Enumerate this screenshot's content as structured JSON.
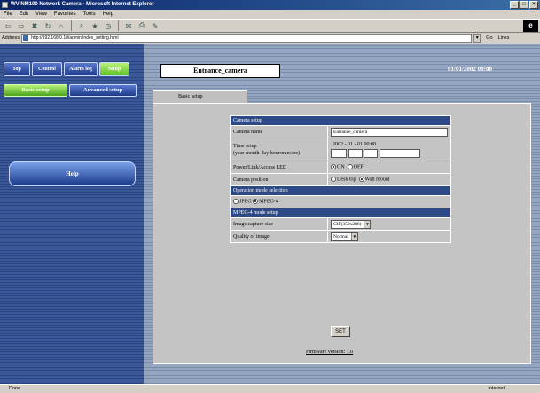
{
  "window": {
    "title": "WV-NM100 Network Camera - Microsoft Internet Explorer"
  },
  "menu": [
    "File",
    "Edit",
    "View",
    "Favorites",
    "Tools",
    "Help"
  ],
  "address": {
    "label": "Address",
    "url": "http://192.168.0.10/admin/index_setting.html",
    "go": "Go",
    "links": "Links"
  },
  "nav": {
    "tabs": [
      {
        "label": "Top",
        "active": false
      },
      {
        "label": "Control",
        "active": false
      },
      {
        "label": "Alarm log",
        "active": false
      },
      {
        "label": "Setup",
        "active": true
      }
    ],
    "subtabs": [
      {
        "label": "Basic setup",
        "active": true
      },
      {
        "label": "Advanced setup",
        "active": false
      }
    ],
    "help": "Help"
  },
  "camera_name": "Entrance_camera",
  "datetime": "01/01/2002  00:00",
  "panel": {
    "tab_label": "Basic setup",
    "camera_setup_header": "Camera setup",
    "camera_name_label": "Camera name",
    "camera_name_value": "Entrance_camera",
    "time_setup_label": "Time setup",
    "time_setup_sub": "(year-month-day hour:min:sec)",
    "time_current": "2002 - 01 - 01   00:00",
    "power_led_label": "Power/Link/Access LED",
    "led_on": "ON",
    "led_off": "OFF",
    "camera_position_label": "Camera position",
    "pos_desk": "Desk top",
    "pos_wall": "Wall mount",
    "op_mode_header": "Operation mode selection",
    "mode_jpeg": "JPEG",
    "mode_mpeg4": "MPEG-4",
    "mpeg4_header": "MPEG-4 mode setup",
    "capture_label": "Image capture size",
    "capture_value": "CIF(352x288)",
    "quality_label": "Quality of image",
    "quality_value": "Normal",
    "set_button": "SET",
    "firmware": "Firmware version: 1.0"
  },
  "status": {
    "left": "Done",
    "zone": "Internet"
  }
}
